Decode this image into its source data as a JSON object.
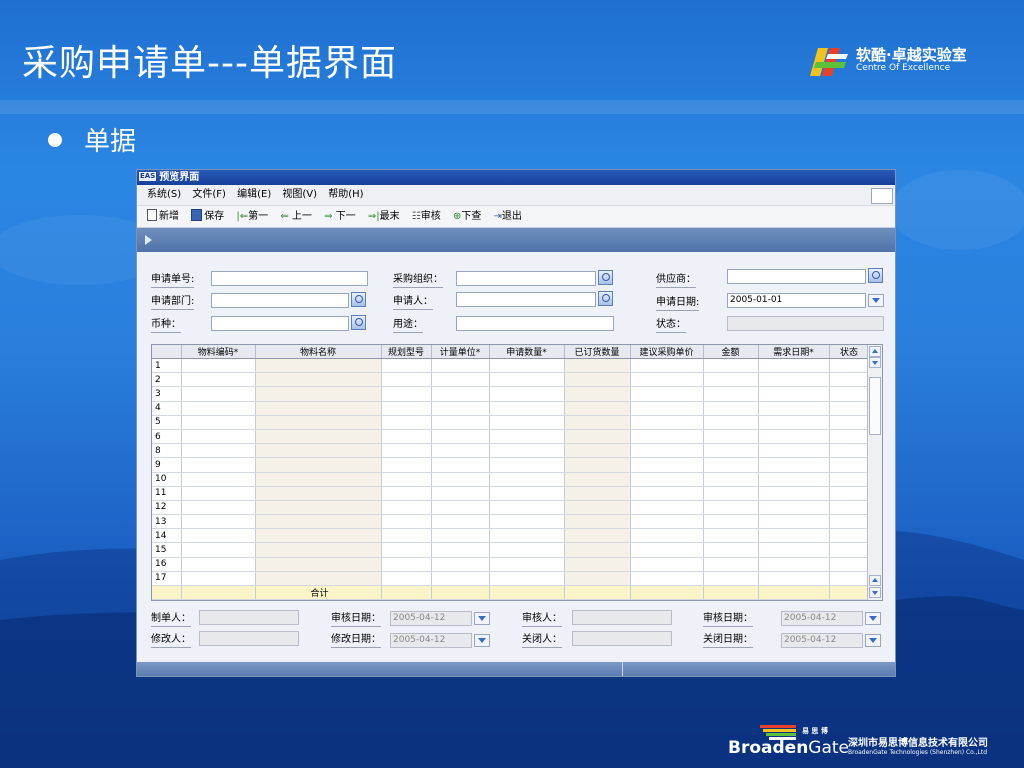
{
  "slide": {
    "title": "采购申请单---单据界面",
    "bullet": "单据",
    "logo_top": {
      "cn": "软酷·卓越实验室",
      "en": "Centre Of Excellence"
    },
    "logo_bottom": {
      "small_cn": "易 思 博",
      "brand_a": "Broaden",
      "brand_b": "Gate",
      "company_cn": "深圳市易思博信息技术有限公司",
      "company_en": "BroadenGate Technologies (Shenzhen) Co.,Ltd"
    }
  },
  "window": {
    "app_icon": "EAS",
    "title": "预览界面",
    "menu": [
      "系统(S)",
      "文件(F)",
      "编辑(E)",
      "视图(V)",
      "帮助(H)"
    ],
    "toolbar": [
      {
        "label": "新增",
        "icon": "new-doc-icon"
      },
      {
        "label": "保存",
        "icon": "save-icon"
      },
      {
        "label": "第一",
        "icon": "first-icon"
      },
      {
        "label": "上一",
        "icon": "prev-icon"
      },
      {
        "label": "下一",
        "icon": "next-icon"
      },
      {
        "label": "最末",
        "icon": "last-icon"
      },
      {
        "label": "审核",
        "icon": "audit-icon"
      },
      {
        "label": "下查",
        "icon": "query-down-icon"
      },
      {
        "label": "退出",
        "icon": "exit-icon"
      }
    ]
  },
  "form": {
    "req_no": {
      "label": "申请单号:",
      "value": ""
    },
    "purchase_org": {
      "label": "采购组织：",
      "value": ""
    },
    "supplier": {
      "label": "供应商：",
      "value": ""
    },
    "dept": {
      "label": "申请部门:",
      "value": ""
    },
    "applicant": {
      "label": "申请人：",
      "value": ""
    },
    "req_date": {
      "label": "申请日期:",
      "value": "2005-01-01"
    },
    "currency": {
      "label": "币种：",
      "value": ""
    },
    "purpose": {
      "label": "用途：",
      "value": ""
    },
    "status": {
      "label": "状态：",
      "value": ""
    }
  },
  "grid": {
    "columns": [
      "",
      "物料编码*",
      "物料名称",
      "规划型号",
      "计量单位*",
      "申请数量*",
      "已订货数量",
      "建议采购单价",
      "金额",
      "需求日期*",
      "状态"
    ],
    "row_numbers": [
      "1",
      "2",
      "3",
      "4",
      "5",
      "6",
      "8",
      "9",
      "10",
      "11",
      "12",
      "13",
      "14",
      "15",
      "16",
      "17"
    ],
    "total_label": "合计"
  },
  "footer": {
    "creator": {
      "label": "制单人：",
      "value": ""
    },
    "audit_date": {
      "label": "审核日期：",
      "value": "2005-04-12"
    },
    "auditor": {
      "label": "审核人：",
      "value": ""
    },
    "audit_date2": {
      "label": "审核日期：",
      "value": "2005-04-12"
    },
    "modifier": {
      "label": "修改人：",
      "value": ""
    },
    "modify_date": {
      "label": "修改日期：",
      "value": "2005-04-12"
    },
    "closer": {
      "label": "关闭人：",
      "value": ""
    },
    "close_date": {
      "label": "关闭日期：",
      "value": "2005-04-12"
    }
  },
  "colors": {
    "accent": "#2b86e3",
    "titlebar": "#1c4aa6",
    "grid_tan": "#f5f1e6",
    "total_row": "#fbf4c8"
  }
}
